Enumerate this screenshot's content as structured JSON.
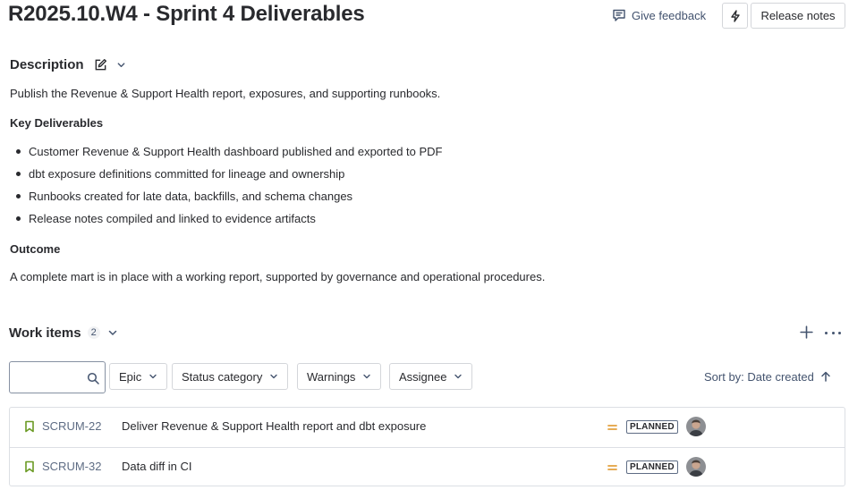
{
  "header": {
    "title": "R2025.10.W4 - Sprint 4 Deliverables",
    "feedback_label": "Give feedback",
    "release_notes_label": "Release notes"
  },
  "description": {
    "heading": "Description",
    "intro": "Publish the Revenue & Support Health report, exposures, and supporting runbooks.",
    "key_heading": "Key Deliverables",
    "items": [
      "Customer Revenue & Support Health dashboard published and exported to PDF",
      "dbt exposure definitions committed for lineage and ownership",
      "Runbooks created for late data, backfills, and schema changes",
      "Release notes compiled and linked to evidence artifacts"
    ],
    "outcome_heading": "Outcome",
    "outcome_text": "A complete mart is in place with a working report, supported by governance and operational procedures."
  },
  "work_items": {
    "heading": "Work items",
    "count": "2",
    "search": {
      "value": "",
      "placeholder": ""
    },
    "filters": [
      "Epic",
      "Status category",
      "Warnings",
      "Assignee"
    ],
    "sort_label": "Sort by: Date created",
    "rows": [
      {
        "key": "SCRUM-22",
        "summary": "Deliver Revenue & Support Health report and dbt exposure",
        "status": "PLANNED",
        "priority": "medium"
      },
      {
        "key": "SCRUM-32",
        "summary": "Data diff in CI",
        "status": "PLANNED",
        "priority": "medium"
      }
    ]
  },
  "icons": {
    "feedback": "feedback-icon",
    "bolt": "lightning-icon",
    "edit": "edit-icon",
    "chevron": "chevron-down-icon",
    "add": "plus-icon",
    "more": "more-icon",
    "search": "search-icon",
    "sort": "arrow-up-icon",
    "story": "bookmark-icon",
    "priority": "priority-medium-icon",
    "avatar": "avatar"
  },
  "colors": {
    "story_icon": "#6a9a23",
    "priority_medium": "#e2a03f",
    "text_primary": "#292a2e",
    "text_secondary": "#44546f",
    "border": "#dcdfe4"
  }
}
